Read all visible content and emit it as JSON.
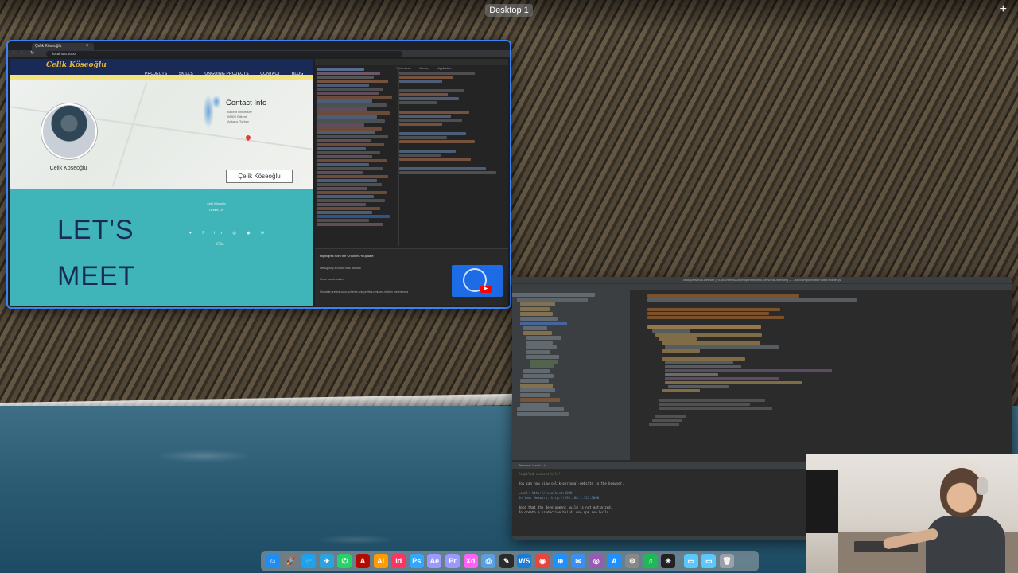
{
  "desktop": {
    "label": "Desktop 1",
    "add_symbol": "+"
  },
  "browser": {
    "tab_title": "Çelik Köseoğlu",
    "tab_close": "×",
    "new_tab": "+",
    "url": "localhost:3000",
    "back_icon": "‹",
    "forward_icon": "›",
    "reload_icon": "↻"
  },
  "site": {
    "logo": "Çelik Köseoğlu",
    "nav": [
      "PROJECTS",
      "SKILLS",
      "ONGOING PROJECTS",
      "CONTACT",
      "BLOG"
    ],
    "person_name": "Çelik Köseoğlu",
    "contact_title": "Contact Info",
    "contact_lines": [
      "Bilkent University",
      "06800 Bilkent",
      "Ankara, Turkey"
    ],
    "name_button": "Çelik Köseoğlu",
    "lets": "LET'S",
    "meet": "MEET",
    "footer_lines": [
      "Çelik Köseoğlu",
      "London, UK"
    ],
    "social_icons": "♥ f in ◎ ◉ ✉",
    "signature": "Gild."
  },
  "devtools": {
    "tabs": [
      "Elements",
      "Console",
      "Sources",
      "Network",
      "Performance",
      "Memory",
      "Application"
    ],
    "whatsnew_title": "Highlights from the Chrome 79 update",
    "whatsnew_lines": [
      "Debug why a cookie was blocked",
      "Show cookie values",
      "Simulate prefers-color-scheme and prefers-reduced-motion preferences"
    ],
    "play_icon": "▶"
  },
  "ide": {
    "title": "celik-personal-website [~/Documents/Development/celik-personal-website] – .../src/components/Footer/Footer.js",
    "terminal_tabs": "Terminal:   Local  ×   +",
    "terminal_lines": [
      "Compiled successfully!",
      "You can now view celik-personal-website in the browser.",
      "Local:            http://localhost:3000",
      "On Your Network:  http://192.168.1.125:3000",
      "Note that the development build is not optimized.",
      "To create a production build, use npm run build."
    ]
  },
  "dock": {
    "icons": [
      "finder-icon",
      "launchpad-icon",
      "twitter-icon",
      "telegram-icon",
      "whatsapp-icon",
      "acrobat-icon",
      "illustrator-icon",
      "indesign-icon",
      "photoshop-icon",
      "aftereffects-icon",
      "premiere-icon",
      "xd-icon",
      "preview-icon",
      "inkscape-icon",
      "webstorm-icon",
      "chrome-icon",
      "safari-icon",
      "mail-icon",
      "podcasts-icon",
      "appstore-icon",
      "settings-icon",
      "spotify-icon",
      "chatgpt-icon",
      "folder-icon",
      "downloads-icon",
      "trash-icon"
    ],
    "glyphs": [
      "☺",
      "🚀",
      "🐦",
      "✈",
      "✆",
      "A",
      "Ai",
      "Id",
      "Ps",
      "Ae",
      "Pr",
      "Xd",
      "⎙",
      "✎",
      "WS",
      "◉",
      "⊕",
      "✉",
      "◎",
      "A",
      "⚙",
      "♫",
      "✳",
      "▭",
      "▭",
      "🗑"
    ],
    "colors": [
      "#1e8ef5",
      "#7b7b7b",
      "#1da1f2",
      "#2aa3df",
      "#25d366",
      "#b30b00",
      "#ff9a00",
      "#ff3366",
      "#31a8ff",
      "#9999ff",
      "#9999ff",
      "#ff61f6",
      "#5aa0e0",
      "#2b2b2b",
      "#1c7cd5",
      "#e8453c",
      "#1e90ff",
      "#3b8ff3",
      "#9b59b6",
      "#1e90ff",
      "#888888",
      "#1db954",
      "#222222",
      "#5ac8fa",
      "#5ac8fa",
      "#9aa0a6"
    ]
  }
}
